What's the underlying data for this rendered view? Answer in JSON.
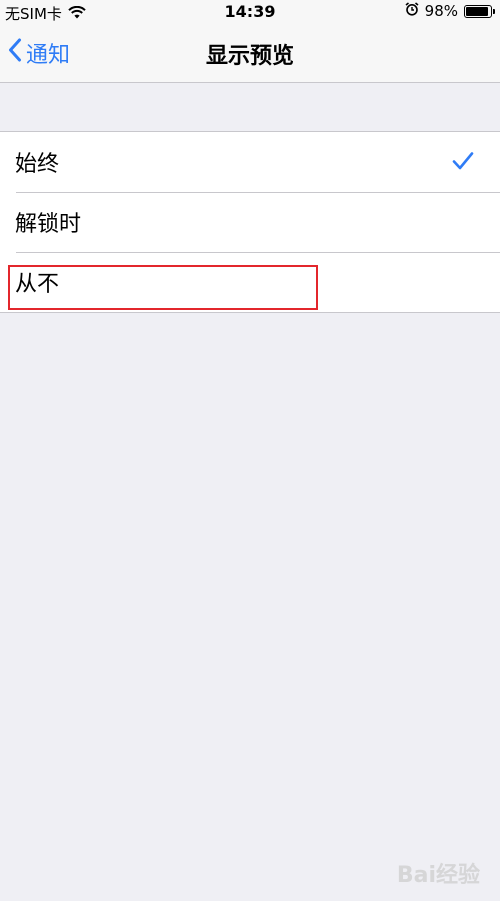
{
  "status_bar": {
    "carrier": "无SIM卡",
    "time": "14:39",
    "battery_percent": "98%",
    "battery_level": 0.98
  },
  "nav": {
    "back_label": "通知",
    "title": "显示预览"
  },
  "options": [
    {
      "label": "始终",
      "selected": true
    },
    {
      "label": "解锁时",
      "selected": false
    },
    {
      "label": "从不",
      "selected": false
    }
  ],
  "colors": {
    "accent": "#2f7cf6",
    "highlight": "#e3262c",
    "background": "#efeff4"
  },
  "watermark": "Bai经验"
}
